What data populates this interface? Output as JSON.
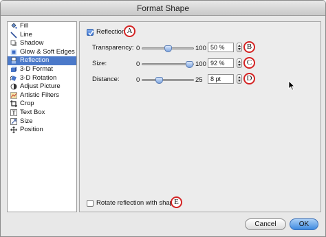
{
  "window": {
    "title": "Format Shape"
  },
  "sidebar": {
    "items": [
      {
        "label": "Fill",
        "icon": "fill-icon"
      },
      {
        "label": "Line",
        "icon": "line-icon"
      },
      {
        "label": "Shadow",
        "icon": "shadow-icon"
      },
      {
        "label": "Glow & Soft Edges",
        "icon": "glow-icon"
      },
      {
        "label": "Reflection",
        "icon": "reflection-icon",
        "selected": true
      },
      {
        "label": "3-D Format",
        "icon": "3d-format-icon"
      },
      {
        "label": "3-D Rotation",
        "icon": "3d-rotation-icon"
      },
      {
        "label": "Adjust Picture",
        "icon": "adjust-picture-icon"
      },
      {
        "label": "Artistic Filters",
        "icon": "artistic-filters-icon"
      },
      {
        "label": "Crop",
        "icon": "crop-icon"
      },
      {
        "label": "Text Box",
        "icon": "text-box-icon"
      },
      {
        "label": "Size",
        "icon": "size-icon"
      },
      {
        "label": "Position",
        "icon": "position-icon"
      }
    ]
  },
  "reflection": {
    "checkbox_label": "Reflection",
    "checked": true,
    "transparency": {
      "label": "Transparency:",
      "min": "0",
      "max": "100",
      "value": "50 %",
      "fraction": 0.5
    },
    "size": {
      "label": "Size:",
      "min": "0",
      "max": "100",
      "value": "92 %",
      "fraction": 0.92
    },
    "distance": {
      "label": "Distance:",
      "min": "0",
      "max": "25",
      "value": "8 pt",
      "fraction": 0.32
    },
    "rotate_label": "Rotate reflection with shape",
    "rotate_checked": false
  },
  "callouts": {
    "a": "A",
    "b": "B",
    "c": "C",
    "d": "D",
    "e": "E"
  },
  "buttons": {
    "cancel": "Cancel",
    "ok": "OK"
  },
  "colors": {
    "selection": "#4b79c9",
    "callout_ring": "#d42323",
    "ok_button": "#3d8ae0"
  }
}
